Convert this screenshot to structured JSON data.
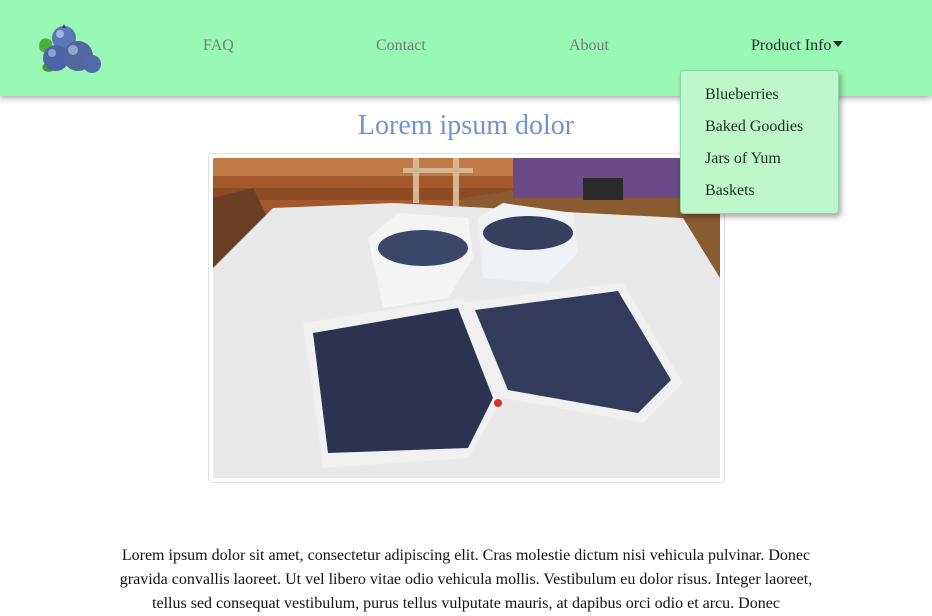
{
  "nav": {
    "logo_icon": "blueberry-cluster-icon",
    "links": [
      "FAQ",
      "Contact",
      "About"
    ],
    "product_info": "Product Info",
    "dropdown_items": [
      "Blueberries",
      "Baked Goodies",
      "Jars of Yum",
      "Baskets"
    ]
  },
  "colors": {
    "navbar_bg": "#99f9b4",
    "dropdown_bg": "#bff7cc",
    "title": "#6f95cc"
  },
  "main": {
    "title": "Lorem ipsum dolor",
    "photo_icon": "blueberries-in-containers-photo",
    "paragraph": "Lorem ipsum dolor sit amet, consectetur adipiscing elit. Cras molestie dictum nisi vehicula pulvinar. Donec gravida convallis laoreet. Ut vel libero vitae odio vehicula mollis. Vestibulum eu dolor risus. Integer laoreet, tellus sed consequat vestibulum, purus tellus vulputate mauris, at dapibus orci odio et arcu. Donec"
  }
}
